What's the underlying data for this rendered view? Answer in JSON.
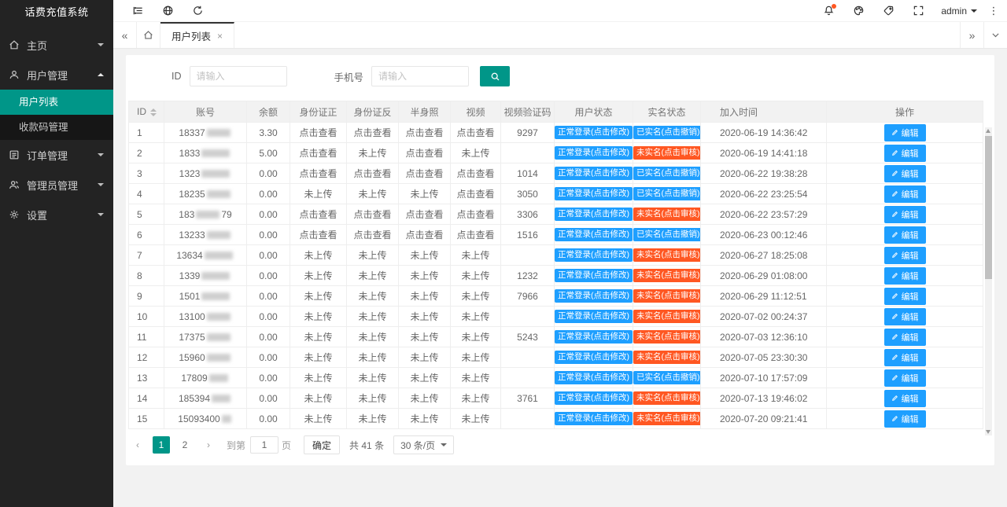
{
  "app": {
    "title": "话费充值系统"
  },
  "sidebar": {
    "items": [
      {
        "label": "主页",
        "icon": "home-icon"
      },
      {
        "label": "用户管理",
        "icon": "user-icon",
        "children": [
          {
            "label": "用户列表",
            "active": true
          },
          {
            "label": "收款码管理",
            "active": false
          }
        ]
      },
      {
        "label": "订单管理",
        "icon": "order-icon"
      },
      {
        "label": "管理员管理",
        "icon": "admins-icon"
      },
      {
        "label": "设置",
        "icon": "gear-icon"
      }
    ]
  },
  "header": {
    "user": "admin"
  },
  "tabs": {
    "active_label": "用户列表"
  },
  "search": {
    "id_label": "ID",
    "id_placeholder": "请输入",
    "phone_label": "手机号",
    "phone_placeholder": "请输入"
  },
  "table": {
    "headers": [
      "ID",
      "账号",
      "余额",
      "身份证正",
      "身份证反",
      "半身照",
      "视频",
      "视频验证码",
      "用户状态",
      "实名状态",
      "加入时间",
      "操作"
    ],
    "edit_label": "编辑",
    "rows": [
      {
        "id": "1",
        "account_prefix": "18337",
        "account_suffix": "",
        "mask": 5,
        "balance": "3.30",
        "id_front": "点击查看",
        "id_back": "点击查看",
        "half_photo": "点击查看",
        "video": "点击查看",
        "video_code": "9297",
        "user_status": "正常登录(点击修改)",
        "real_status": "已实名(点击撤销)",
        "real_type": "verified",
        "join_time": "2020-06-19 14:36:42"
      },
      {
        "id": "2",
        "account_prefix": "1833",
        "account_suffix": "",
        "mask": 6,
        "balance": "5.00",
        "id_front": "点击查看",
        "id_back": "未上传",
        "half_photo": "点击查看",
        "video": "未上传",
        "video_code": "",
        "user_status": "正常登录(点击修改)",
        "real_status": "未实名(点击审核)",
        "real_type": "unverified",
        "join_time": "2020-06-19 14:41:18"
      },
      {
        "id": "3",
        "account_prefix": "1323",
        "account_suffix": "",
        "mask": 6,
        "balance": "0.00",
        "id_front": "点击查看",
        "id_back": "点击查看",
        "half_photo": "点击查看",
        "video": "点击查看",
        "video_code": "1014",
        "user_status": "正常登录(点击修改)",
        "real_status": "已实名(点击撤销)",
        "real_type": "verified",
        "join_time": "2020-06-22 19:38:28"
      },
      {
        "id": "4",
        "account_prefix": "18235",
        "account_suffix": "",
        "mask": 5,
        "balance": "0.00",
        "id_front": "未上传",
        "id_back": "未上传",
        "half_photo": "未上传",
        "video": "点击查看",
        "video_code": "3050",
        "user_status": "正常登录(点击修改)",
        "real_status": "已实名(点击撤销)",
        "real_type": "verified",
        "join_time": "2020-06-22 23:25:54"
      },
      {
        "id": "5",
        "account_prefix": "183",
        "account_suffix": "79",
        "mask": 5,
        "balance": "0.00",
        "id_front": "点击查看",
        "id_back": "点击查看",
        "half_photo": "点击查看",
        "video": "点击查看",
        "video_code": "3306",
        "user_status": "正常登录(点击修改)",
        "real_status": "未实名(点击审核)",
        "real_type": "unverified",
        "join_time": "2020-06-22 23:57:29"
      },
      {
        "id": "6",
        "account_prefix": "13233",
        "account_suffix": "",
        "mask": 5,
        "balance": "0.00",
        "id_front": "点击查看",
        "id_back": "点击查看",
        "half_photo": "点击查看",
        "video": "点击查看",
        "video_code": "1516",
        "user_status": "正常登录(点击修改)",
        "real_status": "已实名(点击撤销)",
        "real_type": "verified",
        "join_time": "2020-06-23 00:12:46"
      },
      {
        "id": "7",
        "account_prefix": "13634",
        "account_suffix": "",
        "mask": 6,
        "balance": "0.00",
        "id_front": "未上传",
        "id_back": "未上传",
        "half_photo": "未上传",
        "video": "未上传",
        "video_code": "",
        "user_status": "正常登录(点击修改)",
        "real_status": "未实名(点击审核)",
        "real_type": "unverified",
        "join_time": "2020-06-27 18:25:08"
      },
      {
        "id": "8",
        "account_prefix": "1339",
        "account_suffix": "",
        "mask": 6,
        "balance": "0.00",
        "id_front": "未上传",
        "id_back": "未上传",
        "half_photo": "未上传",
        "video": "未上传",
        "video_code": "1232",
        "user_status": "正常登录(点击修改)",
        "real_status": "未实名(点击审核)",
        "real_type": "unverified",
        "join_time": "2020-06-29 01:08:00"
      },
      {
        "id": "9",
        "account_prefix": "1501",
        "account_suffix": "",
        "mask": 6,
        "balance": "0.00",
        "id_front": "未上传",
        "id_back": "未上传",
        "half_photo": "未上传",
        "video": "未上传",
        "video_code": "7966",
        "user_status": "正常登录(点击修改)",
        "real_status": "未实名(点击审核)",
        "real_type": "unverified",
        "join_time": "2020-06-29 11:12:51"
      },
      {
        "id": "10",
        "account_prefix": "13100",
        "account_suffix": "",
        "mask": 5,
        "balance": "0.00",
        "id_front": "未上传",
        "id_back": "未上传",
        "half_photo": "未上传",
        "video": "未上传",
        "video_code": "",
        "user_status": "正常登录(点击修改)",
        "real_status": "未实名(点击审核)",
        "real_type": "unverified",
        "join_time": "2020-07-02 00:24:37"
      },
      {
        "id": "11",
        "account_prefix": "17375",
        "account_suffix": "",
        "mask": 5,
        "balance": "0.00",
        "id_front": "未上传",
        "id_back": "未上传",
        "half_photo": "未上传",
        "video": "未上传",
        "video_code": "5243",
        "user_status": "正常登录(点击修改)",
        "real_status": "未实名(点击审核)",
        "real_type": "unverified",
        "join_time": "2020-07-03 12:36:10"
      },
      {
        "id": "12",
        "account_prefix": "15960",
        "account_suffix": "",
        "mask": 5,
        "balance": "0.00",
        "id_front": "未上传",
        "id_back": "未上传",
        "half_photo": "未上传",
        "video": "未上传",
        "video_code": "",
        "user_status": "正常登录(点击修改)",
        "real_status": "未实名(点击审核)",
        "real_type": "unverified",
        "join_time": "2020-07-05 23:30:30"
      },
      {
        "id": "13",
        "account_prefix": "17809",
        "account_suffix": "",
        "mask": 4,
        "balance": "0.00",
        "id_front": "未上传",
        "id_back": "未上传",
        "half_photo": "未上传",
        "video": "未上传",
        "video_code": "",
        "user_status": "正常登录(点击修改)",
        "real_status": "已实名(点击撤销)",
        "real_type": "verified",
        "join_time": "2020-07-10 17:57:09"
      },
      {
        "id": "14",
        "account_prefix": "185394",
        "account_suffix": "",
        "mask": 4,
        "balance": "0.00",
        "id_front": "未上传",
        "id_back": "未上传",
        "half_photo": "未上传",
        "video": "未上传",
        "video_code": "3761",
        "user_status": "正常登录(点击修改)",
        "real_status": "未实名(点击审核)",
        "real_type": "unverified",
        "join_time": "2020-07-13 19:46:02"
      },
      {
        "id": "15",
        "account_prefix": "15093400",
        "account_suffix": "",
        "mask": 2,
        "balance": "0.00",
        "id_front": "未上传",
        "id_back": "未上传",
        "half_photo": "未上传",
        "video": "未上传",
        "video_code": "",
        "user_status": "正常登录(点击修改)",
        "real_status": "未实名(点击审核)",
        "real_type": "unverified",
        "join_time": "2020-07-20 09:21:41"
      }
    ]
  },
  "pagination": {
    "pages": [
      "1",
      "2"
    ],
    "goto_label": "到第",
    "goto_value": "1",
    "page_unit": "页",
    "confirm_label": "确定",
    "total_label": "共 41 条",
    "per_page_label": "30 条/页"
  },
  "colors": {
    "accent_teal": "#009688",
    "badge_blue": "#1e9fff",
    "badge_orange": "#ff5722",
    "sidebar_bg": "#232323"
  }
}
